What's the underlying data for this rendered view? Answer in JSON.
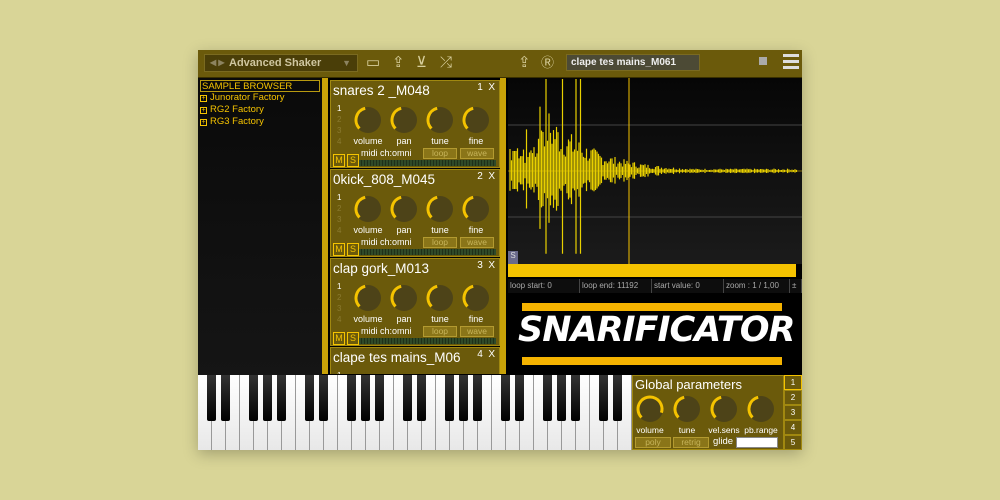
{
  "toolbar": {
    "preset": "Advanced Shaker",
    "sample_name": "clape tes mains_M061"
  },
  "browser": {
    "title": "SAMPLE BROWSER",
    "items": [
      "Junorator Factory",
      "RG2 Factory",
      "RG3 Factory"
    ]
  },
  "slots": [
    {
      "name": "snares 2 _M048",
      "num": "1"
    },
    {
      "name": "0kick_808_M045",
      "num": "2"
    },
    {
      "name": "clap gork_M013",
      "num": "3"
    },
    {
      "name": "clape tes mains_M06",
      "num": "4"
    }
  ],
  "slot_labels": {
    "close": "X",
    "volume": "volume",
    "pan": "pan",
    "tune": "tune",
    "fine": "fine",
    "mute": "M",
    "solo": "S",
    "midi": "midi ch:omni",
    "loop": "loop",
    "wave": "wave",
    "row1": "1",
    "row2": "2",
    "row3": "3",
    "row4": "4"
  },
  "wave": {
    "marker": "S",
    "loop_start": "loop start: 0",
    "loop_end": "loop end: 11192",
    "start_value": "start value: 0",
    "zoom": "zoom : 1 / 1,00",
    "zoom_step": "±"
  },
  "logo": "SNARIFICATOR",
  "global": {
    "title": "Global parameters",
    "knobs": [
      "volume",
      "tune",
      "vel.sens",
      "pb.range"
    ],
    "poly": "poly",
    "retrig": "retrig",
    "glide": "glide"
  },
  "pages": [
    "1",
    "2",
    "3",
    "4",
    "5"
  ],
  "colors": {
    "accent": "#f5c300",
    "panel": "#6b5a0b"
  }
}
